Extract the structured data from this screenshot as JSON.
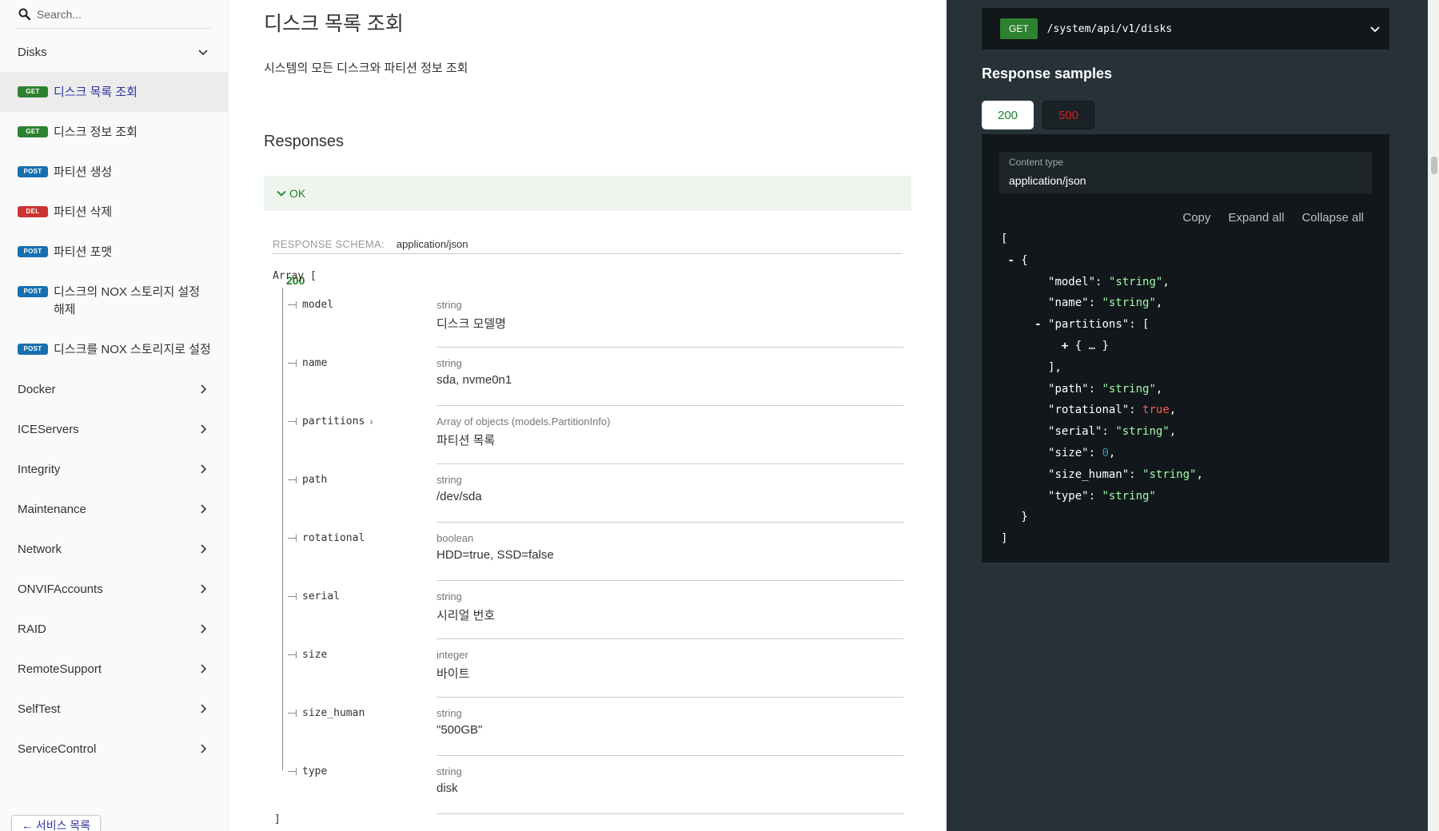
{
  "search": {
    "placeholder": "Search..."
  },
  "sidebar": {
    "open_group": "Disks",
    "operations": [
      {
        "method": "GET",
        "label": "디스크 목록 조회"
      },
      {
        "method": "GET",
        "label": "디스크 정보 조회"
      },
      {
        "method": "POST",
        "label": "파티션 생성"
      },
      {
        "method": "DEL",
        "label": "파티션 삭제"
      },
      {
        "method": "POST",
        "label": "파티션 포맷"
      },
      {
        "method": "POST",
        "label": "디스크의 NOX 스토리지 설정 해제"
      },
      {
        "method": "POST",
        "label": "디스크를 NOX 스토리지로 설정"
      }
    ],
    "groups": [
      "Docker",
      "ICEServers",
      "Integrity",
      "Maintenance",
      "Network",
      "ONVIFAccounts",
      "RAID",
      "RemoteSupport",
      "SelfTest",
      "ServiceControl"
    ],
    "back_label": "← 서비스 목록"
  },
  "main": {
    "title": "디스크 목록 조회",
    "description": "시스템의 모든 디스크와 파티션 정보 조회",
    "responses_title": "Responses",
    "response": {
      "code": "200",
      "desc": "OK"
    },
    "schema_label": "RESPONSE SCHEMA:",
    "schema_value": "application/json",
    "array_open": "Array [",
    "array_close": "]",
    "fields": [
      {
        "name": "model",
        "type": "string",
        "desc": "디스크 모델명"
      },
      {
        "name": "name",
        "type": "string",
        "desc": "sda, nvme0n1"
      },
      {
        "name": "partitions",
        "type": "Array of objects (models.PartitionInfo)",
        "desc": "파티션 목록",
        "expand": "›"
      },
      {
        "name": "path",
        "type": "string",
        "desc": "/dev/sda"
      },
      {
        "name": "rotational",
        "type": "boolean",
        "desc": "HDD=true, SSD=false"
      },
      {
        "name": "serial",
        "type": "string",
        "desc": "시리얼 번호"
      },
      {
        "name": "size",
        "type": "integer",
        "desc": "바이트"
      },
      {
        "name": "size_human",
        "type": "string",
        "desc": "\"500GB\""
      },
      {
        "name": "type",
        "type": "string",
        "desc": "disk"
      }
    ]
  },
  "right": {
    "method": "GET",
    "path": "/system/api/v1/disks",
    "samples_title": "Response samples",
    "tabs": [
      "200",
      "500"
    ],
    "content_type_label": "Content type",
    "content_type_value": "application/json",
    "controls": [
      "Copy",
      "Expand all",
      "Collapse all"
    ],
    "json_keys": {
      "model": "\"model\"",
      "name": "\"name\"",
      "partitions": "\"partitions\"",
      "path": "\"path\"",
      "rotational": "\"rotational\"",
      "serial": "\"serial\"",
      "size": "\"size\"",
      "size_human": "\"size_human\"",
      "type": "\"type\""
    },
    "json_values": {
      "string": "\"string\"",
      "true": "true",
      "zero": "0",
      "collapsed": "{ … }"
    }
  },
  "colors": {
    "get": "#2f8132",
    "post": "#186faf",
    "del": "#cc3333",
    "active_link": "#32329f",
    "ok_green": "#1d8127",
    "error_red": "#d41f1c",
    "panel_bg": "#263238",
    "code_bg": "#11171a",
    "json_string": "#a0fbaa",
    "json_bool": "#f95c4f",
    "json_number": "#4a8bb3"
  }
}
